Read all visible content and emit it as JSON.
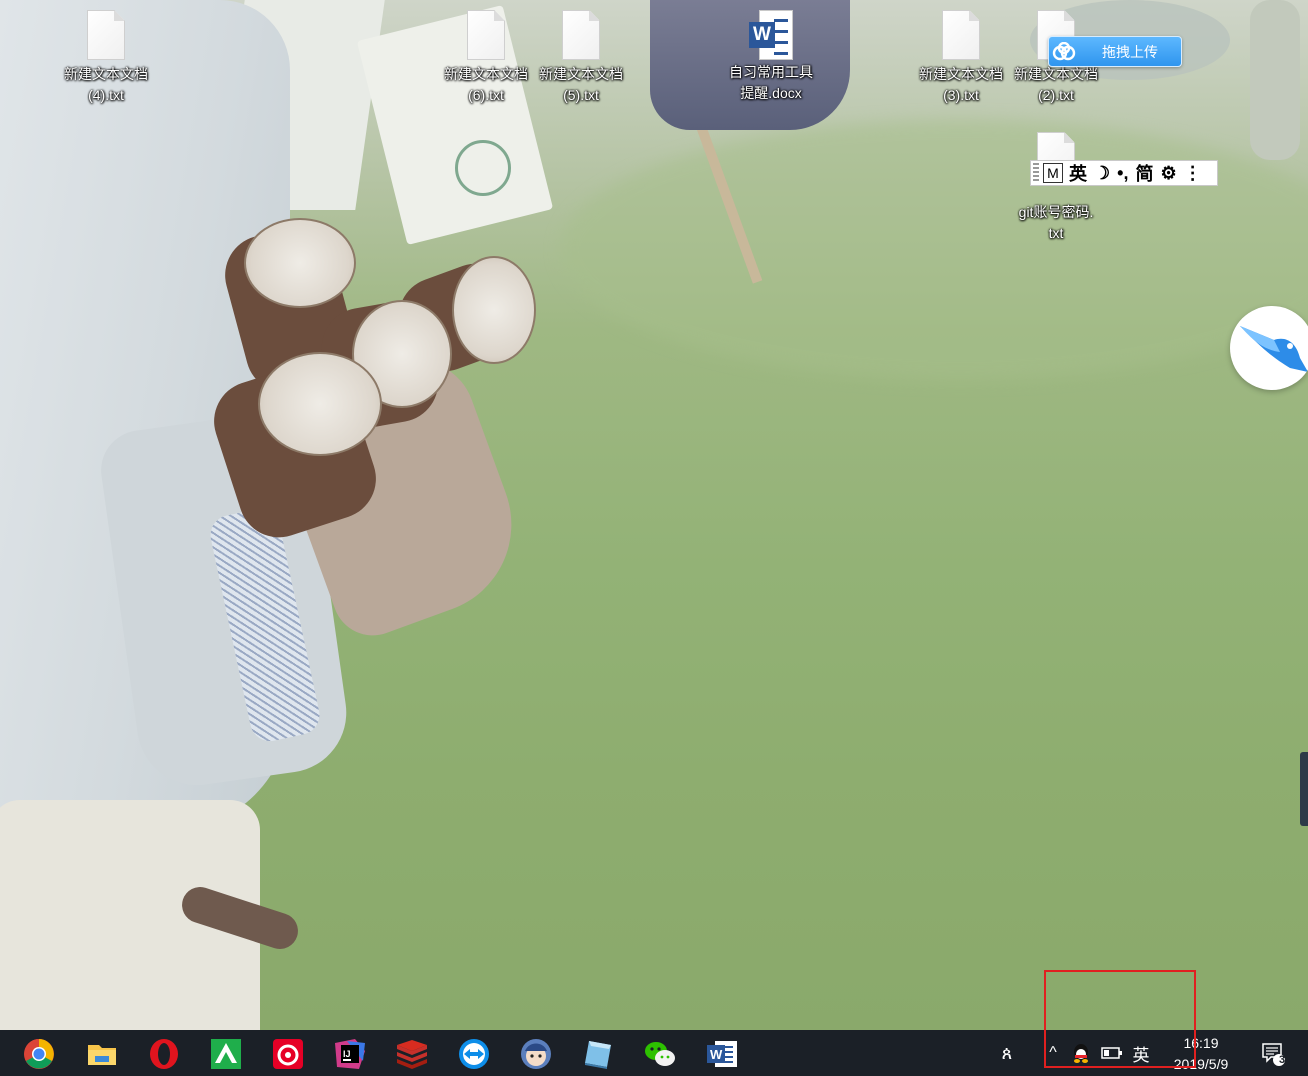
{
  "desktop": {
    "icons": [
      {
        "id": "txt4",
        "label": "新建文本文档\n(4).txt",
        "type": "txt"
      },
      {
        "id": "txt6",
        "label": "新建文本文档\n(6).txt",
        "type": "txt"
      },
      {
        "id": "txt5",
        "label": "新建文本文档\n(5).txt",
        "type": "txt"
      },
      {
        "id": "docx",
        "label": "自习常用工具\n提醒.docx",
        "type": "word"
      },
      {
        "id": "txt3",
        "label": "新建文本文档\n(3).txt",
        "type": "txt"
      },
      {
        "id": "txt2",
        "label": "新建文本文档\n(2).txt",
        "type": "txt"
      },
      {
        "id": "git",
        "label": "git账号密码.\ntxt",
        "type": "txt"
      }
    ],
    "word_badge": "W"
  },
  "baidu_upload": {
    "label": "拖拽上传"
  },
  "ime_bar": {
    "m": "M",
    "lang": "英",
    "moon": "☽",
    "punct": "•,",
    "simp": "简",
    "gear": "⚙",
    "more": "⋮"
  },
  "taskbar": {
    "apps": [
      "chrome",
      "file-explorer",
      "opera",
      "green-app",
      "netease-music",
      "intellij-idea",
      "redis-desktop",
      "teamviewer",
      "avatar-app",
      "blue-app",
      "wechat",
      "word"
    ],
    "word_badge": "W",
    "idea_badge": "IJ"
  },
  "tray": {
    "people_icon": "ጰ",
    "chevron": "^",
    "ime_lang": "英",
    "time": "16:19",
    "date": "2019/5/9",
    "notification_count": "3"
  },
  "colors": {
    "taskbar": "#1b2027",
    "highlight": "#e02020",
    "baidu_blue": "#2f95ee"
  }
}
